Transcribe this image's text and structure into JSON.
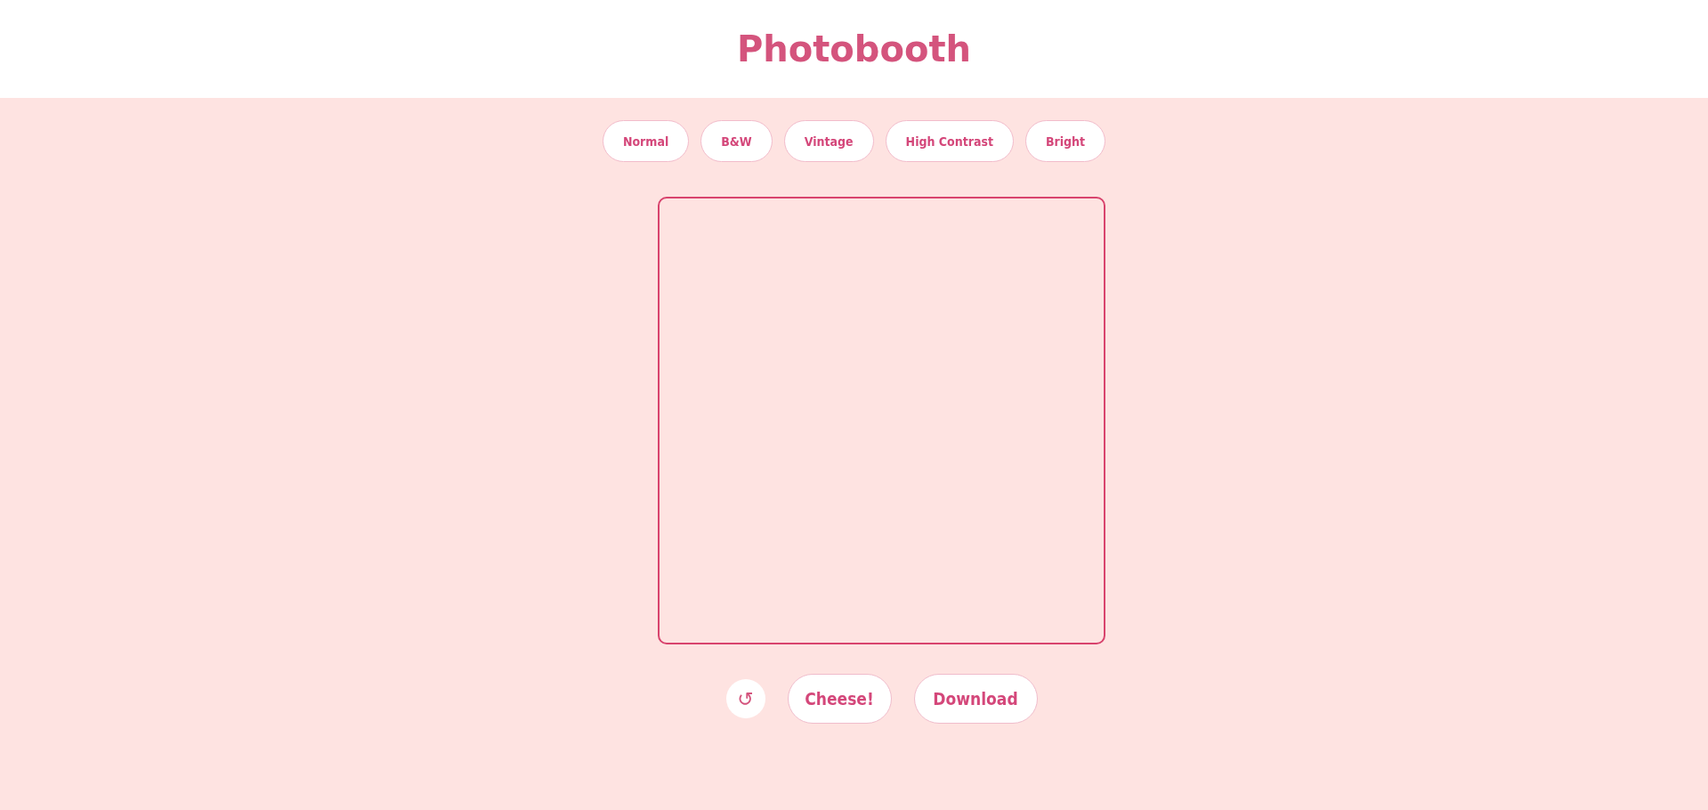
{
  "header": {
    "title": "Photobooth"
  },
  "filters": [
    {
      "label": "Normal"
    },
    {
      "label": "B&W"
    },
    {
      "label": "Vintage"
    },
    {
      "label": "High Contrast"
    },
    {
      "label": "Bright"
    }
  ],
  "controls": {
    "reset": "↺",
    "capture": "Cheese!",
    "download": "Download"
  }
}
